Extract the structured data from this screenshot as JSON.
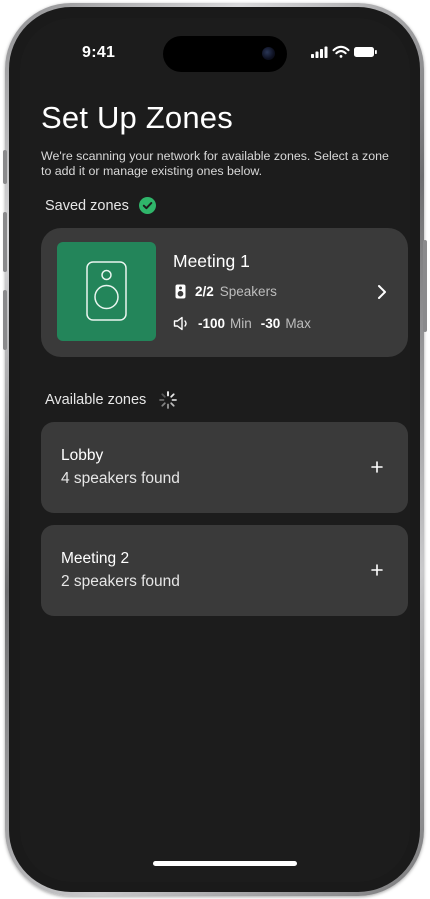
{
  "status_bar": {
    "time": "9:41",
    "icons": [
      "cellular-signal-icon",
      "wifi-icon",
      "battery-icon"
    ]
  },
  "header": {
    "title": "Set Up Zones",
    "description": "We're scanning your network for available zones. Select a zone to add it or manage existing ones below."
  },
  "saved_zones": {
    "label": "Saved zones",
    "status_icon": "check-circle-icon",
    "items": [
      {
        "name": "Meeting 1",
        "speakers_count": "2/2",
        "speakers_label": "Speakers",
        "volume_min": "-100",
        "volume_min_label": "Min",
        "volume_max": "-30",
        "volume_max_label": "Max",
        "thumbnail_icon": "speaker-icon",
        "action_icon": "chevron-right-icon"
      }
    ]
  },
  "available_zones": {
    "label": "Available zones",
    "status_icon": "loading-spinner-icon",
    "items": [
      {
        "name": "Lobby",
        "subtitle": "4 speakers found",
        "action_icon": "plus-icon"
      },
      {
        "name": "Meeting 2",
        "subtitle": "2 speakers found",
        "action_icon": "plus-icon"
      }
    ]
  },
  "colors": {
    "background": "#1c1c1c",
    "card": "#3a3a3a",
    "accent_green": "#23855a",
    "check_green": "#2fb56a",
    "text_primary": "#ffffff",
    "text_secondary": "#bdbdbd"
  }
}
